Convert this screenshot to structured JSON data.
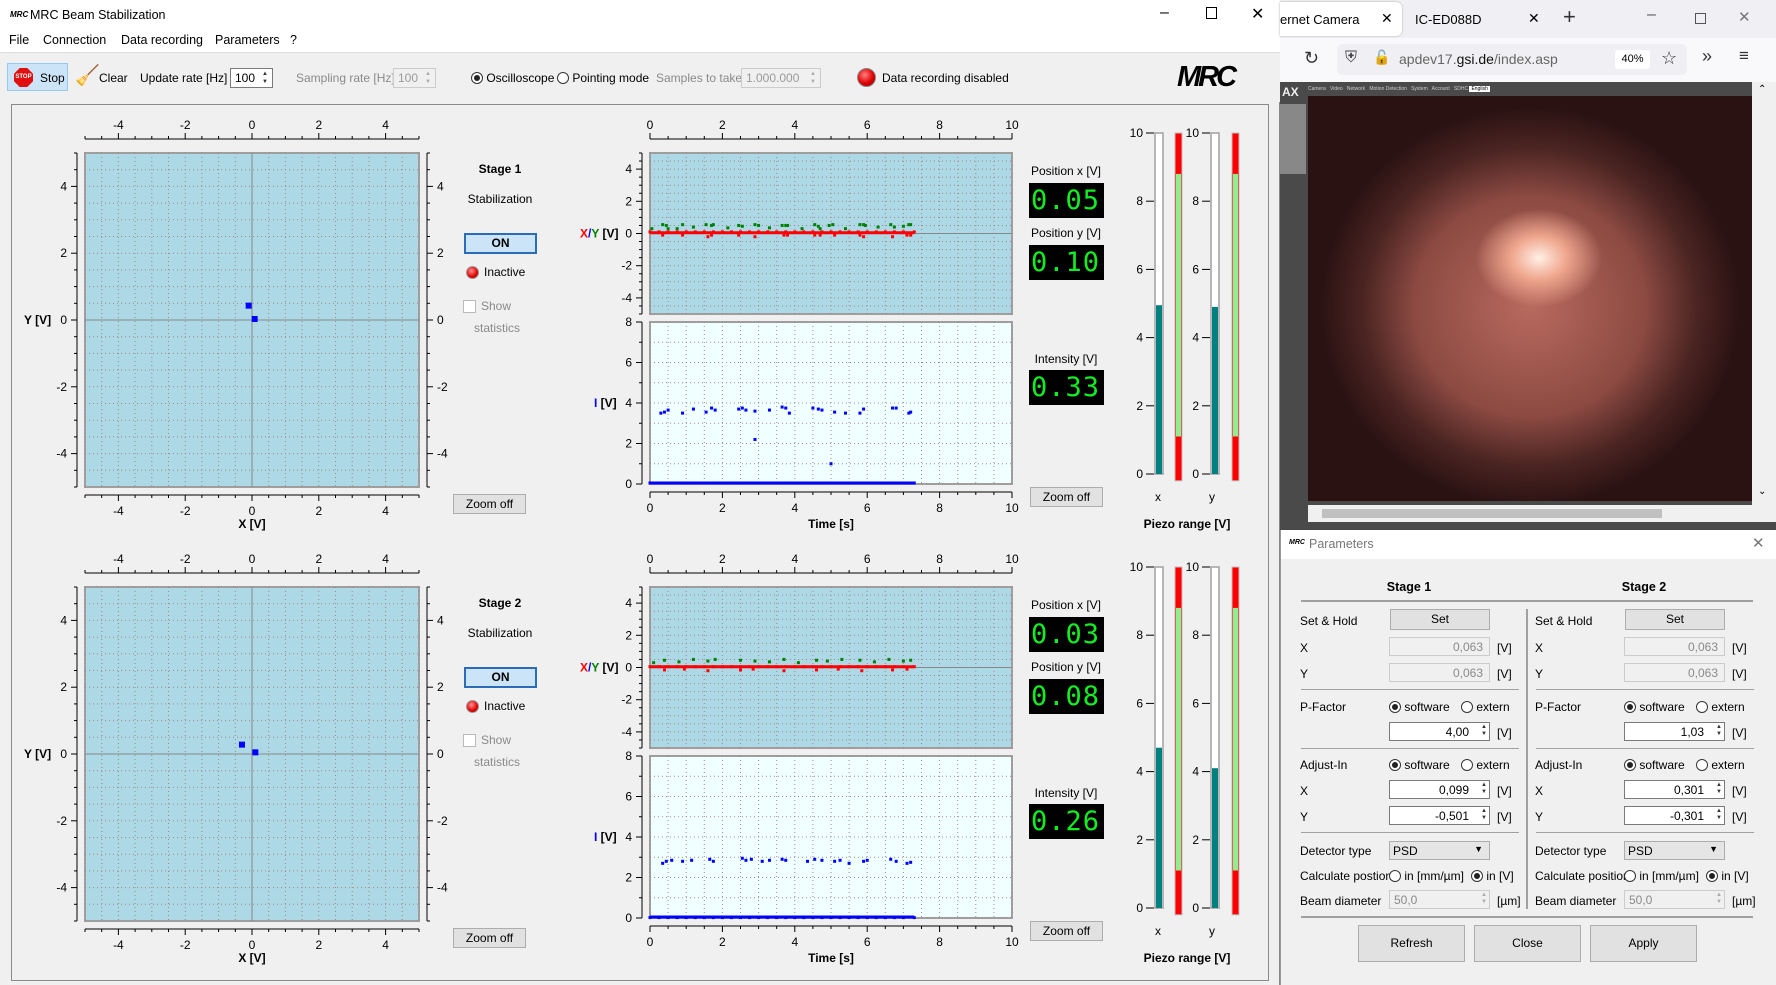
{
  "app": {
    "title": "MRC Beam Stabilization",
    "window_controls": [
      "minimize-icon",
      "maximize-icon",
      "close-icon"
    ],
    "menu": [
      "File",
      "Connection",
      "Data recording",
      "Parameters",
      "?"
    ],
    "toolbar": {
      "stop_label": "Stop",
      "stop_icon_text": "STOP",
      "clear_label": "Clear",
      "update_rate_label": "Update rate [Hz]",
      "update_rate_value": "100",
      "sampling_rate_label": "Sampling rate [Hz]",
      "sampling_rate_value": "100",
      "mode_oscilloscope": "Oscilloscope",
      "mode_pointing": "Pointing mode",
      "selected_mode": "Oscilloscope",
      "samples_label": "Samples to take",
      "samples_value": "1.000.000",
      "recording_status": "Data recording disabled",
      "logo": "MRC"
    }
  },
  "colors": {
    "plot_bg": "#add8e6",
    "intensity_bg": "#f0ffff",
    "x_series": "#ff0000",
    "y_series": "#008000",
    "i_series": "#0000ff",
    "piezo_fill": "#008080",
    "ok_range": "#90ee90",
    "limit": "#ff0000",
    "lcd_text": "#11ee22"
  },
  "stages": [
    {
      "title": "Stage 1",
      "stabilization_label": "Stabilization",
      "on_label": "ON",
      "status": "Inactive",
      "show_label": "Show",
      "statistics_label": "statistics",
      "zoom_off": "Zoom off",
      "zoom_off_2": "Zoom off",
      "scatter": {
        "xlabel": "X [V]",
        "ylabel": "Y [V]",
        "xlim": [
          -5,
          5
        ],
        "ylim": [
          -5,
          5
        ],
        "points": [
          [
            -0.1,
            0.43
          ],
          [
            0.08,
            0.03
          ]
        ]
      },
      "timeplot": {
        "xlabel": "Time [s]",
        "xlim": [
          0,
          10
        ],
        "top_ylabel": {
          "x": "X",
          "sep": "/",
          "y": "Y",
          "unit": " [V]"
        },
        "top_ylim": [
          -5,
          5
        ],
        "bottom_ylabel": {
          "i": "I",
          "unit": " [V]"
        },
        "bottom_ylim": [
          0,
          8
        ],
        "x_series": {
          "t": [
            0,
            0.25,
            0.5,
            0.75,
            1,
            1.25,
            1.5,
            1.75,
            2,
            2.25,
            2.5,
            2.75,
            3,
            3.25,
            3.5,
            3.75,
            4,
            4.25,
            4.5,
            4.75,
            5,
            5.25,
            5.5,
            5.75,
            6,
            6.25,
            6.5,
            6.75,
            7,
            7.3,
            0.35,
            0.9,
            1.6,
            1.7,
            2.45,
            2.9,
            3.7,
            3.8,
            4.55,
            4.7,
            5.1,
            5.8,
            5.9,
            6.7,
            7.1,
            7.2
          ],
          "v": [
            0.1,
            0.1,
            0.1,
            0.1,
            0.1,
            0.1,
            0.1,
            0.1,
            0.1,
            0.1,
            0.1,
            0.1,
            0.1,
            0.1,
            0.1,
            0.1,
            0.1,
            0.1,
            0.1,
            0.1,
            0.1,
            0.1,
            0.1,
            0.1,
            0.1,
            0.1,
            0.1,
            0.1,
            0.1,
            0.1,
            -0.1,
            -0.1,
            -0.2,
            -0.1,
            -0.1,
            -0.2,
            -0.1,
            -0.1,
            -0.1,
            -0.1,
            -0.1,
            -0.1,
            -0.2,
            -0.2,
            -0.1,
            -0.1
          ]
        },
        "y_series": {
          "t": [
            0.05,
            0.35,
            0.45,
            0.5,
            0.75,
            0.9,
            1.2,
            1.55,
            1.7,
            1.75,
            2.15,
            2.45,
            2.55,
            2.9,
            3,
            3.3,
            3.65,
            3.75,
            3.8,
            4.2,
            4.55,
            4.65,
            4.7,
            4.95,
            5.05,
            5.4,
            5.8,
            5.9,
            5.95,
            6.3,
            6.65,
            6.75,
            7,
            7.15,
            7.2
          ],
          "v": [
            0.3,
            0.55,
            0.5,
            0.3,
            0.3,
            0.55,
            0.4,
            0.55,
            0.5,
            0.55,
            0.35,
            0.5,
            0.45,
            0.55,
            0.5,
            0.35,
            0.5,
            0.5,
            0.5,
            0.3,
            0.55,
            0.45,
            0.3,
            0.5,
            0.55,
            0.3,
            0.55,
            0.55,
            0.5,
            0.4,
            0.55,
            0.4,
            0.45,
            0.55,
            0.55
          ]
        },
        "i_series": {
          "t": [
            0,
            0.25,
            0.5,
            0.75,
            1,
            1.25,
            1.5,
            1.75,
            2,
            2.25,
            2.5,
            2.75,
            3,
            3.25,
            3.5,
            3.75,
            4,
            4.25,
            4.5,
            4.75,
            5,
            5.25,
            5.5,
            5.75,
            6,
            6.25,
            6.5,
            6.75,
            7,
            7.3,
            0.3,
            0.4,
            0.5,
            0.9,
            1.2,
            1.55,
            1.7,
            1.8,
            2.45,
            2.55,
            2.65,
            2.9,
            3.3,
            3.65,
            3.75,
            3.85,
            4.5,
            4.65,
            4.75,
            5.1,
            5.4,
            5.8,
            5.9,
            6.7,
            6.8,
            7.15,
            7.2,
            2.9,
            5.0
          ],
          "v": [
            0.05,
            0.05,
            0.05,
            0.05,
            0.05,
            0.05,
            0.05,
            0.05,
            0.05,
            0.05,
            0.05,
            0.05,
            0.05,
            0.05,
            0.05,
            0.05,
            0.05,
            0.05,
            0.05,
            0.05,
            0.05,
            0.05,
            0.05,
            0.05,
            0.05,
            0.05,
            0.05,
            0.05,
            0.05,
            0.05,
            3.5,
            3.55,
            3.65,
            3.5,
            3.7,
            3.55,
            3.75,
            3.65,
            3.7,
            3.75,
            3.65,
            3.6,
            3.65,
            3.8,
            3.75,
            3.5,
            3.75,
            3.7,
            3.65,
            3.55,
            3.5,
            3.5,
            3.7,
            3.75,
            3.75,
            3.5,
            3.55,
            2.2,
            1.0
          ]
        }
      },
      "readouts": {
        "pos_x_label": "Position x [V]",
        "pos_x": "0.05",
        "pos_y_label": "Position y [V]",
        "pos_y": "0.10",
        "intensity_label": "Intensity [V]",
        "intensity": "0.33"
      },
      "piezo": {
        "title": "Piezo range [V]",
        "x_label": "x",
        "y_label": "y",
        "range": [
          0,
          10
        ],
        "x_value": 4.95,
        "y_value": 4.9,
        "ok_range": [
          1.1,
          8.8
        ]
      }
    },
    {
      "title": "Stage 2",
      "stabilization_label": "Stabilization",
      "on_label": "ON",
      "status": "Inactive",
      "show_label": "Show",
      "statistics_label": "statistics",
      "zoom_off": "Zoom off",
      "zoom_off_2": "Zoom off",
      "scatter": {
        "xlabel": "X [V]",
        "ylabel": "Y [V]",
        "xlim": [
          -5,
          5
        ],
        "ylim": [
          -5,
          5
        ],
        "points": [
          [
            -0.3,
            0.28
          ],
          [
            0.1,
            0.05
          ]
        ]
      },
      "timeplot": {
        "xlabel": "Time [s]",
        "xlim": [
          0,
          10
        ],
        "top_ylabel": {
          "x": "X",
          "sep": "/",
          "y": "Y",
          "unit": " [V]"
        },
        "top_ylim": [
          -5,
          5
        ],
        "bottom_ylabel": {
          "i": "I",
          "unit": " [V]"
        },
        "bottom_ylim": [
          0,
          8
        ],
        "x_series": {
          "t": [
            0,
            0.25,
            0.5,
            0.75,
            1,
            1.25,
            1.5,
            1.75,
            2,
            2.25,
            2.5,
            2.75,
            3,
            3.25,
            3.5,
            3.75,
            4,
            4.25,
            4.5,
            4.75,
            5,
            5.25,
            5.5,
            5.75,
            6,
            6.25,
            6.5,
            6.75,
            7,
            7.3,
            0.4,
            0.95,
            1.6,
            2.5,
            2.85,
            3.7,
            4.6,
            5.2,
            5.85,
            6.7,
            7.1
          ],
          "v": [
            0.05,
            0.05,
            0.05,
            0.05,
            0.05,
            0.05,
            0.05,
            0.05,
            0.05,
            0.05,
            0.05,
            0.05,
            0.05,
            0.05,
            0.05,
            0.05,
            0.05,
            0.05,
            0.05,
            0.05,
            0.05,
            0.05,
            0.05,
            0.05,
            0.05,
            0.05,
            0.05,
            0.05,
            0.05,
            0.05,
            -0.15,
            -0.1,
            -0.2,
            -0.15,
            -0.1,
            -0.2,
            -0.15,
            -0.1,
            -0.2,
            -0.15,
            -0.1
          ]
        },
        "y_series": {
          "t": [
            0.1,
            0.4,
            0.8,
            1.2,
            1.6,
            1.8,
            2.5,
            2.9,
            3.3,
            3.7,
            4.1,
            4.6,
            4.9,
            5.3,
            5.8,
            6.2,
            6.6,
            7.0,
            7.2
          ],
          "v": [
            0.3,
            0.45,
            0.35,
            0.5,
            0.4,
            0.5,
            0.45,
            0.4,
            0.35,
            0.5,
            0.3,
            0.45,
            0.4,
            0.5,
            0.45,
            0.35,
            0.5,
            0.4,
            0.45
          ]
        },
        "i_series": {
          "t": [
            0,
            0.25,
            0.5,
            0.75,
            1,
            1.25,
            1.5,
            1.75,
            2,
            2.25,
            2.5,
            2.75,
            3,
            3.25,
            3.5,
            3.75,
            4,
            4.25,
            4.5,
            4.75,
            5,
            5.25,
            5.5,
            5.75,
            6,
            6.25,
            6.5,
            6.75,
            7,
            7.3,
            0.35,
            0.45,
            0.6,
            0.9,
            1.15,
            1.65,
            1.75,
            2.55,
            2.65,
            2.8,
            3.1,
            3.3,
            3.65,
            3.75,
            4.35,
            4.55,
            4.75,
            5.1,
            5.25,
            5.5,
            5.9,
            6.0,
            6.65,
            6.8,
            7.1,
            7.2
          ],
          "v": [
            0.02,
            0.02,
            0.02,
            0.02,
            0.02,
            0.02,
            0.02,
            0.02,
            0.02,
            0.02,
            0.02,
            0.02,
            0.02,
            0.02,
            0.02,
            0.02,
            0.02,
            0.02,
            0.02,
            0.02,
            0.02,
            0.02,
            0.02,
            0.02,
            0.02,
            0.02,
            0.02,
            0.02,
            0.02,
            0.02,
            2.7,
            2.8,
            2.85,
            2.8,
            2.85,
            2.9,
            2.8,
            2.95,
            2.85,
            2.9,
            2.8,
            2.85,
            2.9,
            2.85,
            2.8,
            2.9,
            2.85,
            2.8,
            2.85,
            2.7,
            2.8,
            2.85,
            2.9,
            2.8,
            2.7,
            2.75
          ]
        }
      },
      "readouts": {
        "pos_x_label": "Position x [V]",
        "pos_x": "0.03",
        "pos_y_label": "Position y [V]",
        "pos_y": "0.08",
        "intensity_label": "Intensity [V]",
        "intensity": "0.26"
      },
      "piezo": {
        "title": "Piezo range [V]",
        "x_label": "x",
        "y_label": "y",
        "range": [
          0,
          10
        ],
        "x_value": 4.7,
        "y_value": 4.1,
        "ok_range": [
          1.1,
          8.8
        ]
      }
    }
  ],
  "browser": {
    "tabs": [
      {
        "label": "ernet Camera",
        "active": true
      },
      {
        "label": "IC-ED088D",
        "active": false
      }
    ],
    "url_host_pre": "apdev17.",
    "url_host": "gsi.de",
    "url_path": "/index.asp",
    "zoom": "40%",
    "page_brand": "AX",
    "page_nav": [
      "Camera",
      "Video",
      "Network",
      "Motion Detection",
      "System",
      "Account",
      "SDHC"
    ],
    "language": "English"
  },
  "parameters": {
    "title": "Parameters",
    "logo": "MRC",
    "columns": [
      {
        "title": "Stage 1",
        "set_hold_label": "Set & Hold",
        "set_button": "Set",
        "x_label": "X",
        "x_value": "0,063",
        "y_label": "Y",
        "y_value": "0,063",
        "unit_v": "[V]",
        "pfactor_label": "P-Factor",
        "software": "software",
        "extern": "extern",
        "pfactor_mode": "software",
        "pfactor_value": "4,00",
        "adjust_label": "Adjust-In",
        "adjust_mode": "software",
        "adjust_x": "0,099",
        "adjust_y": "-0,501",
        "detector_label": "Detector type",
        "detector_value": "PSD",
        "calc_label": "Calculate postion",
        "calc_mm": "in [mm/µm]",
        "calc_v": "in [V]",
        "calc_mode": "in [V]",
        "beam_label": "Beam diameter",
        "beam_value": "50,0",
        "unit_um": "[µm]"
      },
      {
        "title": "Stage 2",
        "set_hold_label": "Set & Hold",
        "set_button": "Set",
        "x_label": "X",
        "x_value": "0,063",
        "y_label": "Y",
        "y_value": "0,063",
        "unit_v": "[V]",
        "pfactor_label": "P-Factor",
        "software": "software",
        "extern": "extern",
        "pfactor_mode": "software",
        "pfactor_value": "1,03",
        "adjust_label": "Adjust-In",
        "adjust_mode": "software",
        "adjust_x": "0,301",
        "adjust_y": "-0,301",
        "detector_label": "Detector type",
        "detector_value": "PSD",
        "calc_label": "Calculate position",
        "calc_mm": "in [mm/µm]",
        "calc_v": "in [V]",
        "calc_mode": "in [V]",
        "beam_label": "Beam diameter",
        "beam_value": "50,0",
        "unit_um": "[µm]"
      }
    ],
    "buttons": {
      "refresh": "Refresh",
      "close": "Close",
      "apply": "Apply"
    }
  }
}
